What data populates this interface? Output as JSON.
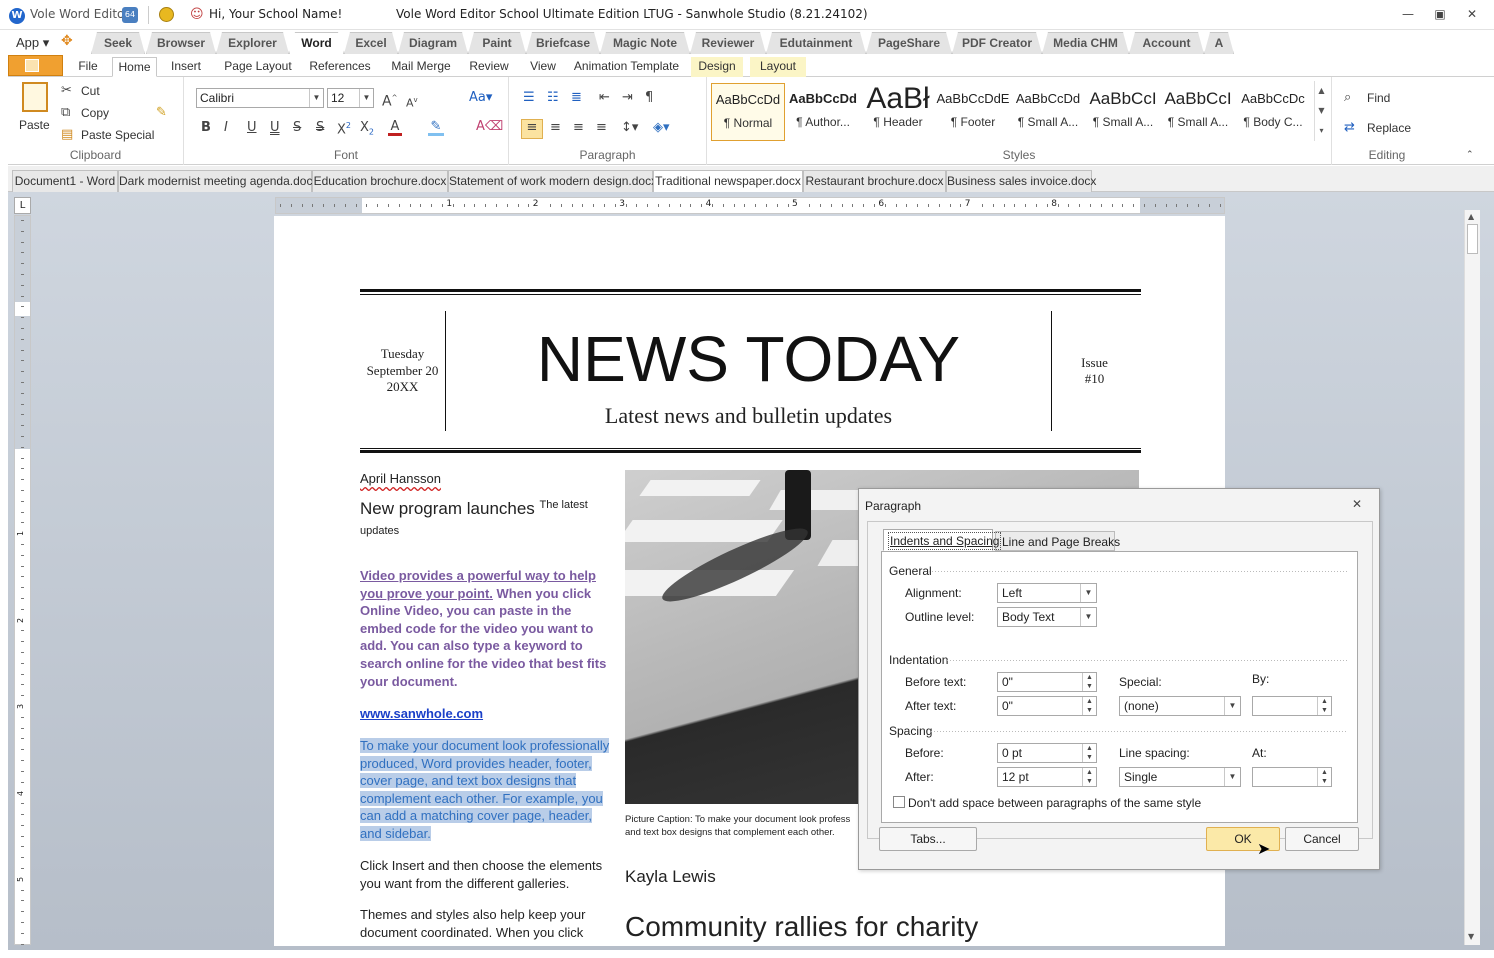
{
  "titlebar": {
    "app_name": "Vole Word Editor",
    "greeting": "Hi, Your School Name!",
    "title": "Vole Word Editor School Ultimate Edition LTUG - Sanwhole Studio (8.21.24102)",
    "badge": "64"
  },
  "app_menu": "App",
  "top_tabs": [
    "Seek",
    "Browser",
    "Explorer",
    "Word",
    "Excel",
    "Diagram",
    "Paint",
    "Briefcase",
    "Magic Note",
    "Reviewer",
    "Edutainment",
    "PageShare",
    "PDF Creator",
    "Media CHM",
    "Account",
    "A"
  ],
  "ribbon_tabs": [
    "File",
    "Home",
    "Insert",
    "Page Layout",
    "References",
    "Mail Merge",
    "Review",
    "View",
    "Animation Template",
    "Design",
    "Layout"
  ],
  "clipboard": {
    "paste": "Paste",
    "cut": "Cut",
    "copy": "Copy",
    "paste_special": "Paste Special",
    "label": "Clipboard"
  },
  "font": {
    "name": "Calibri",
    "size": "12",
    "label": "Font"
  },
  "paragraph_label": "Paragraph",
  "styles": {
    "label": "Styles",
    "items": [
      {
        "preview": "AaBbCcDd",
        "name": "¶ Normal"
      },
      {
        "preview": "AaBbCcDd",
        "name": "¶ Author..."
      },
      {
        "preview": "AaBł",
        "name": "¶ Header"
      },
      {
        "preview": "AaBbCcDdE",
        "name": "¶ Footer"
      },
      {
        "preview": "AaBbCcDd",
        "name": "¶ Small A..."
      },
      {
        "preview": "AaBbCcI",
        "name": "¶ Small A..."
      },
      {
        "preview": "AaBbCcI",
        "name": "¶ Small A..."
      },
      {
        "preview": "AaBbCcDc",
        "name": "¶ Body C..."
      }
    ]
  },
  "editing": {
    "find": "Find",
    "replace": "Replace",
    "label": "Editing"
  },
  "doc_tabs": [
    "Document1 - Word",
    "Dark modernist meeting agenda.docx",
    "Education brochure.docx",
    "Statement of work modern design.docx",
    "Traditional newspaper.docx",
    "Restaurant brochure.docx",
    "Business sales invoice.docx"
  ],
  "ruler": {
    "h": [
      "1",
      "2",
      "3",
      "4",
      "5",
      "6",
      "7",
      "8"
    ],
    "v": [
      "1",
      "2",
      "3",
      "4",
      "5"
    ]
  },
  "doc": {
    "date1": "Tuesday",
    "date2": "September 20",
    "date3": "20XX",
    "masthead": "NEWS TODAY",
    "subtitle": "Latest news and bulletin updates",
    "issue1": "Issue",
    "issue2": "#10",
    "author1": "April Hansson",
    "headline1": "New program launches",
    "headline1_small": "The latest",
    "headline1_small2": "updates",
    "link_part": "Video provides a powerful way to help you prove your point.",
    "purple_rest": " When you click Online Video, you can paste in the embed code for the video you want to add. You can also type a keyword to search online for the video that best fits your document.",
    "url": "www.sanwhole.com",
    "selected_text": "To make your document look professionally produced, Word provides header, footer, cover page, and text box designs that complement each other. For example, you can add a matching cover page, header, and sidebar.",
    "para_insert": "Click Insert and then choose the elements you want from the different galleries.",
    "para_themes": "Themes and styles also help keep your document coordinated. When you click",
    "caption1": "Picture Caption: To make your document look profess",
    "caption2": "and text box designs that complement each other.",
    "author2": "Kayla Lewis",
    "headline2": "Community rallies for charity"
  },
  "dialog": {
    "title": "Paragraph",
    "tab1": "Indents and Spacing",
    "tab2": "Line and Page Breaks",
    "general": "General",
    "alignment_label": "Alignment:",
    "alignment": "Left",
    "outline_label": "Outline level:",
    "outline": "Body Text",
    "indentation": "Indentation",
    "before_text_label": "Before text:",
    "before_text": "0\"",
    "after_text_label": "After text:",
    "after_text": "0\"",
    "special_label": "Special:",
    "special": "(none)",
    "by_label": "By:",
    "by": "",
    "spacing": "Spacing",
    "before_label": "Before:",
    "before": "0 pt",
    "after_label": "After:",
    "after": "12 pt",
    "line_spacing_label": "Line spacing:",
    "line_spacing": "Single",
    "at_label": "At:",
    "at": "",
    "dont_add": "Don't add space between paragraphs of the same style",
    "tabs_btn": "Tabs...",
    "ok_btn": "OK",
    "cancel_btn": "Cancel"
  },
  "colors": {
    "accent_purple": "#7a5aa0",
    "link_blue": "#1a3fc8",
    "selection": "#b9cde8",
    "ok_bg": "#fbe9a8"
  }
}
